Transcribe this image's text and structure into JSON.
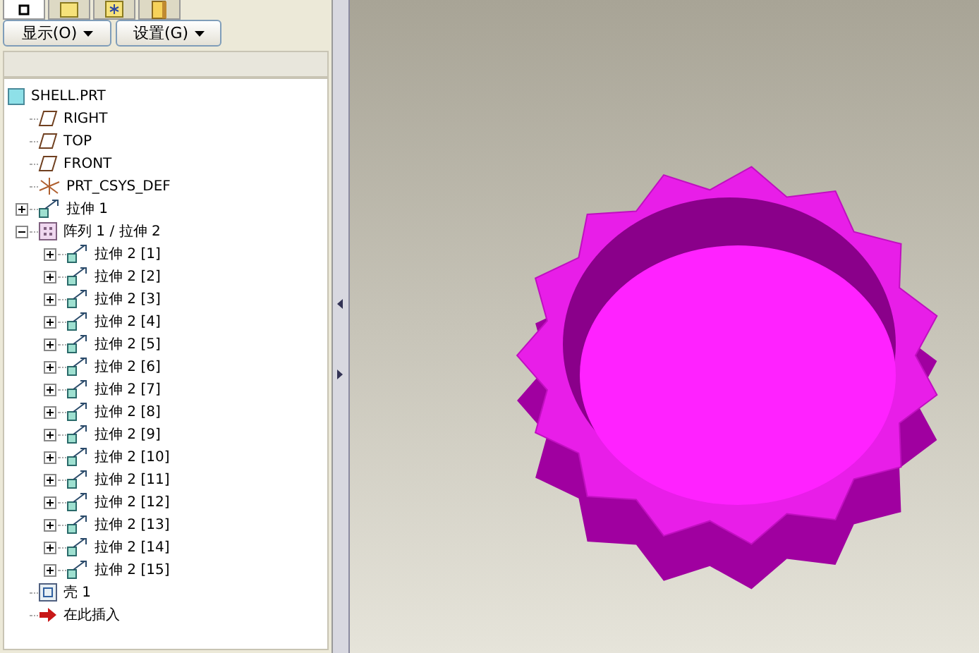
{
  "tabs": [
    {
      "kind": "tree",
      "selected": true
    },
    {
      "kind": "folder",
      "selected": false
    },
    {
      "kind": "star",
      "selected": false
    },
    {
      "kind": "book",
      "selected": false
    }
  ],
  "buttons": [
    {
      "label": "显示(O)"
    },
    {
      "label": "设置(G)"
    }
  ],
  "tree": {
    "label": "SHELL.PRT",
    "kind": "part",
    "children": [
      {
        "label": "RIGHT",
        "kind": "plane"
      },
      {
        "label": "TOP",
        "kind": "plane"
      },
      {
        "label": "FRONT",
        "kind": "plane"
      },
      {
        "label": "PRT_CSYS_DEF",
        "kind": "csys"
      },
      {
        "label": "拉伸 1",
        "kind": "extrude",
        "expanded": false
      },
      {
        "label": "阵列 1 / 拉伸 2",
        "kind": "pattern",
        "expanded": true,
        "children": [
          {
            "label": "拉伸 2 [1]",
            "kind": "extrude",
            "expanded": false
          },
          {
            "label": "拉伸 2 [2]",
            "kind": "extrude",
            "expanded": false
          },
          {
            "label": "拉伸 2 [3]",
            "kind": "extrude",
            "expanded": false
          },
          {
            "label": "拉伸 2 [4]",
            "kind": "extrude",
            "expanded": false
          },
          {
            "label": "拉伸 2 [5]",
            "kind": "extrude",
            "expanded": false
          },
          {
            "label": "拉伸 2 [6]",
            "kind": "extrude",
            "expanded": false
          },
          {
            "label": "拉伸 2 [7]",
            "kind": "extrude",
            "expanded": false
          },
          {
            "label": "拉伸 2 [8]",
            "kind": "extrude",
            "expanded": false
          },
          {
            "label": "拉伸 2 [9]",
            "kind": "extrude",
            "expanded": false
          },
          {
            "label": "拉伸 2 [10]",
            "kind": "extrude",
            "expanded": false
          },
          {
            "label": "拉伸 2 [11]",
            "kind": "extrude",
            "expanded": false
          },
          {
            "label": "拉伸 2 [12]",
            "kind": "extrude",
            "expanded": false
          },
          {
            "label": "拉伸 2 [13]",
            "kind": "extrude",
            "expanded": false
          },
          {
            "label": "拉伸 2 [14]",
            "kind": "extrude",
            "expanded": false
          },
          {
            "label": "拉伸 2 [15]",
            "kind": "extrude",
            "expanded": false
          }
        ]
      },
      {
        "label": "壳 1",
        "kind": "shell"
      },
      {
        "label": "在此插入",
        "kind": "insert"
      }
    ]
  }
}
